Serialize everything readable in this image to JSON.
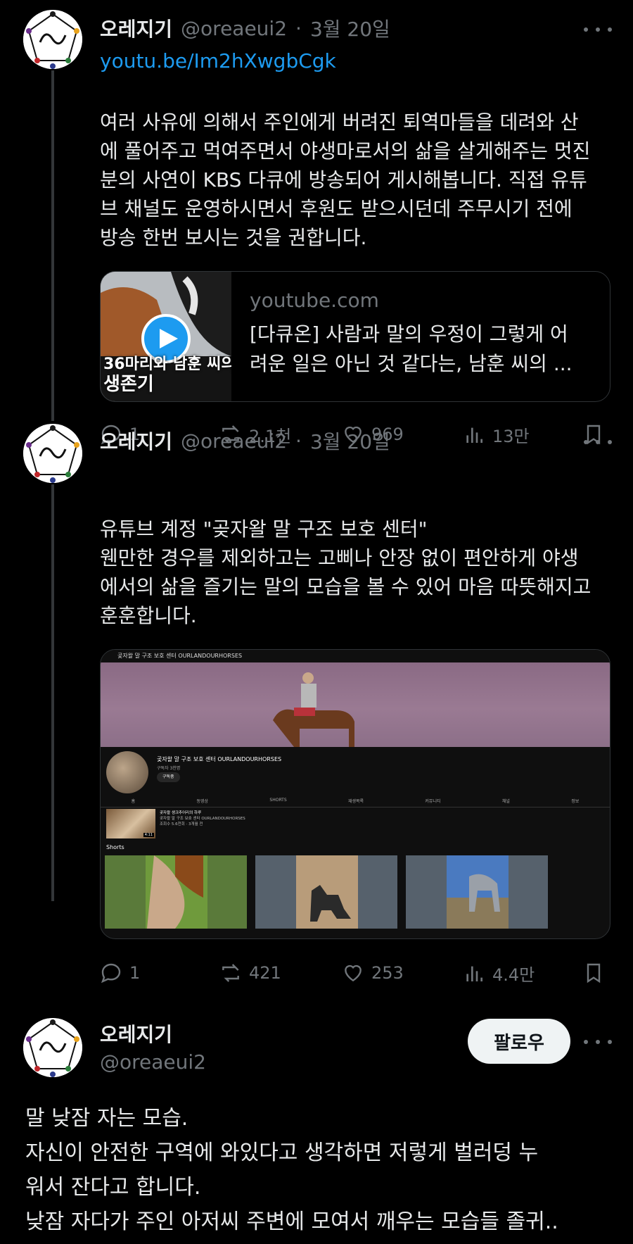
{
  "tweets": [
    {
      "name": "오레지기",
      "handle": "@oreaeui2",
      "separator": "·",
      "date": "3월 20일",
      "link": "youtu.be/Im2hXwgbCgk",
      "text": [
        "여러 사유에 의해서 주인에게 버려진 퇴역마들을 데려와 산",
        "에 풀어주고 먹여주면서 야생마로서의 삶을 살게해주는 멋진",
        "분의 사연이 KBS 다큐에 방송되어 게시해봅니다. 직접 유튜",
        "브 채널도 운영하시면서 후원도 받으시던데 주무시기 전에",
        "방송 한번 보시는 것을 권합니다."
      ],
      "card": {
        "thumb_text": [
          "36마리와 남훈 씨의",
          "생존기"
        ],
        "domain": "youtube.com",
        "title_lines": [
          "[다큐온] 사람과 말의 우정이 그렇게 어",
          "려운 일은 아닌 것 같다는, 남훈 씨의 ..."
        ]
      },
      "stats": {
        "replies": "1",
        "reposts": "2.1천",
        "likes": "969",
        "views": "13만"
      }
    },
    {
      "name": "오레지기",
      "handle": "@oreaeui2",
      "separator": "·",
      "date": "3월 20일",
      "text": [
        "유튜브 계정 \"곶자왈 말 구조 보호 센터\"",
        "웬만한 경우를 제외하고는 고삐나 안장 없이 편안하게 야생",
        "에서의 삶을 즐기는 말의 모습을 볼 수 있어 마음 따뜻해지고",
        "훈훈합니다."
      ],
      "screenshot": {
        "top_title": "곶자왈 말 구조 보호 센터 OURLANDOURHORSES",
        "channel_name": "곶자왈 말 구조 보호 센터 OURLANDOURHORSES",
        "subscribers": "구독자 3천명",
        "subscribe_button": "구독중",
        "tabs": [
          "홈",
          "동영상",
          "SHORTS",
          "재생목록",
          "커뮤니티",
          "채널",
          "정보"
        ],
        "featured_lines": [
          "곶자왈 생크추어리의 하루",
          "곶자왈 말 구조 보호 센터 OURLANDOURHORSES",
          "조회수 5.6천회 · 3개월 전"
        ],
        "featured_badge": "4:11",
        "shorts_label": "Shorts"
      },
      "stats": {
        "replies": "1",
        "reposts": "421",
        "likes": "253",
        "views": "4.4만"
      }
    }
  ],
  "main_tweet": {
    "name": "오레지기",
    "handle": "@oreaeui2",
    "follow_label": "팔로우",
    "text": [
      "말 낮잠 자는 모습.",
      "자신이 안전한 구역에 와있다고 생각하면 저렇게 벌러덩 누",
      "워서 잔다고 합니다.",
      "낮잠 자다가 주인 아저씨 주변에 모여서 깨우는 모습들 졸귀.."
    ]
  },
  "colors": {
    "background": "#000000",
    "text": "#e7e9ea",
    "muted": "#71767b",
    "link": "#1d9bf0",
    "border": "#2f3336"
  }
}
